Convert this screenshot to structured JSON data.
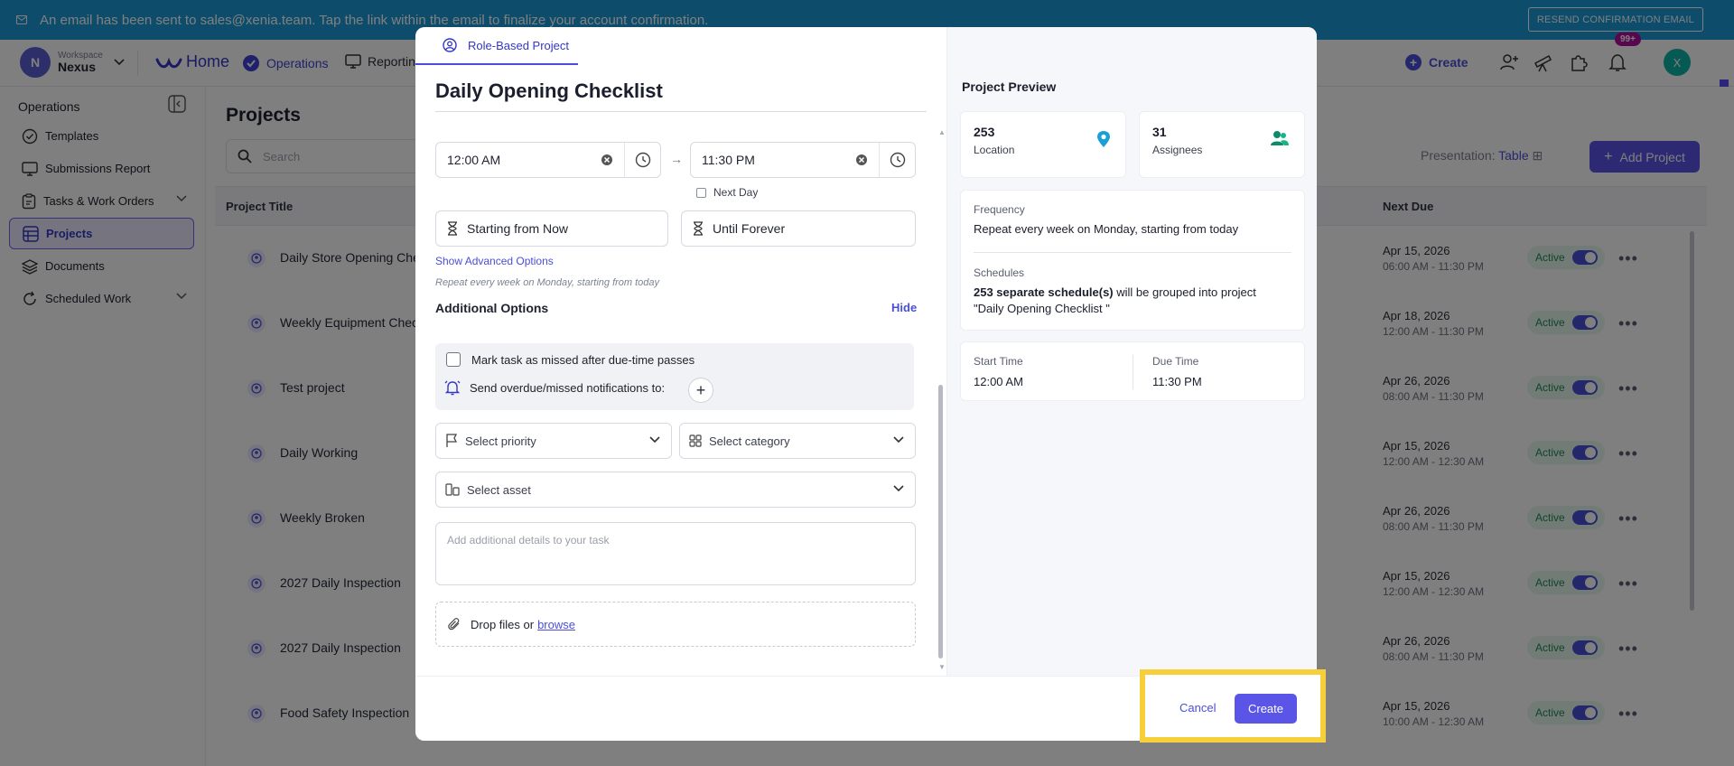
{
  "banner": {
    "message": "An email has been sent to sales@xenia.team. Tap the link within the email to finalize your account confirmation.",
    "button": "RESEND CONFIRMATION EMAIL"
  },
  "topnav": {
    "workspace_caption": "Workspace",
    "workspace_name": "Nexus",
    "workspace_initial": "N",
    "home": "Home",
    "operations": "Operations",
    "reporting": "Reporting",
    "create": "Create",
    "notifications_badge": "99+",
    "user_initial": "X"
  },
  "sidebar": {
    "title": "Operations",
    "items": [
      {
        "label": "Templates",
        "icon": "check-circle-icon"
      },
      {
        "label": "Submissions Report",
        "icon": "monitor-icon"
      },
      {
        "label": "Tasks & Work Orders",
        "icon": "clipboard-icon"
      },
      {
        "label": "Projects",
        "icon": "projects-icon"
      },
      {
        "label": "Documents",
        "icon": "layers-icon"
      },
      {
        "label": "Scheduled Work",
        "icon": "refresh-icon"
      }
    ]
  },
  "main": {
    "title": "Projects",
    "search_placeholder": "Search",
    "presentation_label": "Presentation:",
    "presentation_value": "Table",
    "add_project": "Add Project",
    "col_title": "Project Title",
    "col_next_due": "Next Due",
    "rows": [
      {
        "name": "Daily Store Opening Checklist",
        "date": "Apr 15, 2026",
        "time": "06:00 AM - 11:30 PM",
        "status": "Active"
      },
      {
        "name": "Weekly Equipment Check",
        "date": "Apr 18, 2026",
        "time": "12:00 AM - 11:30 PM",
        "status": "Active"
      },
      {
        "name": "Test project",
        "date": "Apr 26, 2026",
        "time": "08:00 AM - 11:30 PM",
        "status": "Active"
      },
      {
        "name": "Daily Working",
        "date": "Apr 15, 2026",
        "time": "12:00 AM - 12:30 AM",
        "status": "Active"
      },
      {
        "name": "Weekly Broken",
        "date": "Apr 26, 2026",
        "time": "08:00 AM - 11:30 PM",
        "status": "Active"
      },
      {
        "name": "2027 Daily Inspection",
        "date": "Apr 15, 2026",
        "time": "12:00 AM - 12:30 AM",
        "status": "Active"
      },
      {
        "name": "2027 Daily Inspection",
        "date": "Apr 26, 2026",
        "time": "08:00 AM - 11:30 PM",
        "status": "Active"
      },
      {
        "name": "Food Safety Inspection",
        "date": "Apr 15, 2026",
        "time": "10:00 AM - 12:30 AM",
        "status": "Active"
      }
    ]
  },
  "modal": {
    "tab": "Role-Based Project",
    "title": "Daily Opening Checklist",
    "start_time": "12:00 AM",
    "end_time": "11:30 PM",
    "next_day": "Next Day",
    "starting": "Starting from Now",
    "until": "Until Forever",
    "advanced": "Show Advanced Options",
    "repeat_note": "Repeat every week on Monday, starting from today",
    "additional_options": "Additional Options",
    "hide": "Hide",
    "missed_option": "Mark task as missed after due-time passes",
    "notify_option": "Send overdue/missed notifications to:",
    "priority_placeholder": "Select priority",
    "category_placeholder": "Select category",
    "asset_placeholder": "Select asset",
    "details_placeholder": "Add additional details to your task",
    "drop_text": "Drop files or",
    "browse": "browse",
    "cancel": "Cancel",
    "create": "Create"
  },
  "preview": {
    "title": "Project Preview",
    "location_count": "253",
    "location_label": "Location",
    "assignees_count": "31",
    "assignees_label": "Assignees",
    "frequency_label": "Frequency",
    "frequency_value": "Repeat every week on Monday, starting from today",
    "schedules_label": "Schedules",
    "schedules_bold": "253 separate schedule(s)",
    "schedules_rest": " will be grouped into project",
    "schedules_project": "\"Daily Opening Checklist \"",
    "start_label": "Start Time",
    "start_value": "12:00 AM",
    "due_label": "Due Time",
    "due_value": "11:30 PM"
  },
  "colors": {
    "banner": "#1a9bd7",
    "accent": "#4a4edb",
    "highlight": "#f7cf3a"
  }
}
